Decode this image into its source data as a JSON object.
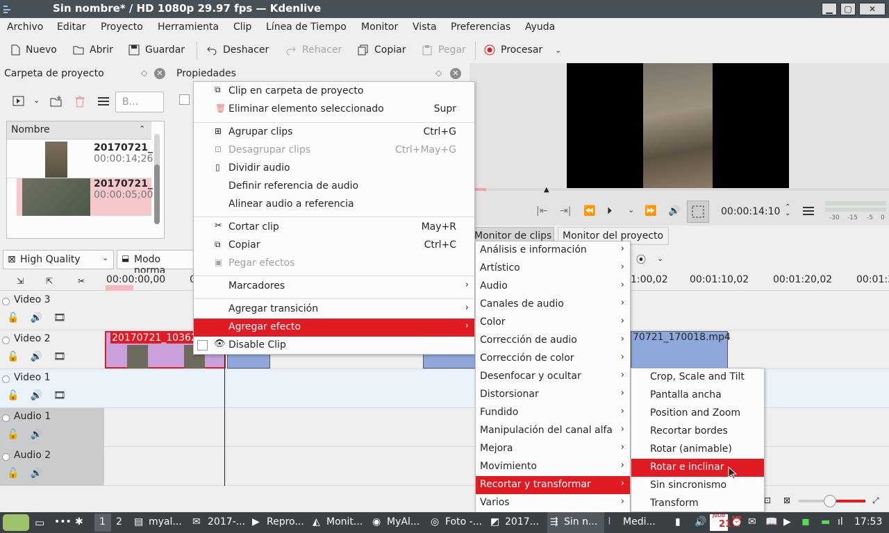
{
  "window": {
    "title": "Sin nombre* / HD 1080p 29.97 fps — Kdenlive",
    "min": "▁",
    "max": "▢",
    "close": "✕"
  },
  "menubar": [
    "Archivo",
    "Editar",
    "Proyecto",
    "Herramienta",
    "Clip",
    "Línea de Tiempo",
    "Monitor",
    "Vista",
    "Preferencias",
    "Ayuda"
  ],
  "toolbar": {
    "nuevo": "Nuevo",
    "abrir": "Abrir",
    "guardar": "Guardar",
    "deshacer": "Deshacer",
    "rehacer": "Rehacer",
    "copiar": "Copiar",
    "pegar": "Pegar",
    "procesar": "Procesar"
  },
  "project_bin": {
    "title": "Carpeta de proyecto",
    "search_placeholder": "B...",
    "column": "Nombre",
    "clips": [
      {
        "name": "20170721_",
        "duration": "00:00:14;26"
      },
      {
        "name": "20170721_",
        "duration": "00:00:05;00"
      }
    ]
  },
  "properties": {
    "title": "Propiedades"
  },
  "monitor": {
    "timecode": "00:00:14:10",
    "tabs": [
      "Monitor de clips",
      "Monitor del proyecto"
    ],
    "meter_labels": [
      "-30",
      "-15",
      "-5",
      "0"
    ]
  },
  "timeline_controls": {
    "quality": "High Quality",
    "mode": "Modo norma"
  },
  "ruler": [
    "00:00:00,00",
    "0",
    "1:00,02",
    "00:01:10,02",
    "00:01:20,02",
    "00:01:3"
  ],
  "tracks": [
    {
      "name": "Video 3"
    },
    {
      "name": "Video 2"
    },
    {
      "name": "Video 1"
    },
    {
      "name": "Audio 1"
    },
    {
      "name": "Audio 2"
    }
  ],
  "clips": {
    "clip_a": "20170721_10362",
    "clip_b": "70721_170018.mp4"
  },
  "context_menu": [
    {
      "label": "Clip en carpeta de proyecto",
      "shortcut": ""
    },
    {
      "label": "Eliminar elemento seleccionado",
      "shortcut": "Supr"
    },
    {
      "label": "Agrupar clips",
      "shortcut": "Ctrl+G"
    },
    {
      "label": "Desagrupar clips",
      "shortcut": "Ctrl+May+G"
    },
    {
      "label": "Dividir audio",
      "shortcut": ""
    },
    {
      "label": "Definir referencia de audio",
      "shortcut": ""
    },
    {
      "label": "Alinear audio a referencia",
      "shortcut": ""
    },
    {
      "label": "Cortar clip",
      "shortcut": "May+R"
    },
    {
      "label": "Copiar",
      "shortcut": "Ctrl+C"
    },
    {
      "label": "Pegar efectos",
      "shortcut": ""
    },
    {
      "label": "Marcadores",
      "shortcut": ""
    },
    {
      "label": "Agregar transición",
      "shortcut": ""
    },
    {
      "label": "Agregar efecto",
      "shortcut": ""
    },
    {
      "label": "Disable Clip",
      "shortcut": ""
    }
  ],
  "effects_menu": [
    "Análisis e información",
    "Artístico",
    "Audio",
    "Canales de audio",
    "Color",
    "Corrección de audio",
    "Corrección de color",
    "Desenfocar y ocultar",
    "Distorsionar",
    "Fundido",
    "Manipulación del canal alfa",
    "Mejora",
    "Movimiento",
    "Recortar y transformar",
    "Varios"
  ],
  "transform_menu": [
    "Crop, Scale and Tilt",
    "Pantalla ancha",
    "Position and Zoom",
    "Recortar bordes",
    "Rotar (animable)",
    "Rotar e inclinar",
    "Sin sincronismo",
    "Transform"
  ],
  "taskbar": {
    "desktops": [
      "1",
      "2"
    ],
    "tasks": [
      "myal...",
      "2017-...",
      "Repro...",
      "Monit...",
      "MyAl...",
      "Foto -...",
      "2017...",
      "Sin n...",
      "Medi..."
    ],
    "clock": "17:53",
    "calendar_day": "21",
    "calendar_month": "JULIO"
  },
  "colors": {
    "accent": "#e01b24",
    "titlebar": "#475057",
    "clip_purple": "#c9a0dc",
    "clip_blue": "#8fa8dc"
  }
}
